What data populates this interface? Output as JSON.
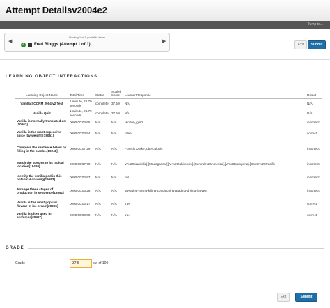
{
  "header": {
    "title": "Attempt Detailsv2004e2"
  },
  "topbar": {
    "jump_label": "Jump to..."
  },
  "pager": {
    "count_text": "Viewing 1 of 1 gradable items",
    "user_name": "Fred Bloggs (Attempt 1 of 1)"
  },
  "actions": {
    "exit_label": "Exit",
    "submit_label": "Submit"
  },
  "interactions": {
    "section_title": "LEARNING OBJECT INTERACTIONS",
    "columns": [
      "Learning Object Name",
      "Total Time",
      "Status",
      "Scaled Score",
      "Learner Response",
      "Result"
    ],
    "rows": [
      {
        "name": "Vanilla SCORM 2004 v2 Test",
        "time": "1 minute, 26.79 seconds",
        "status": "complete",
        "score": "37.5%",
        "response": "N/A",
        "result": "N/A"
      },
      {
        "name": "Vanilla Quiz",
        "time": "1 minute, 26.79 seconds",
        "status": "complete",
        "score": "37.5%",
        "response": "N/A",
        "result": "N/A"
      },
      {
        "name": "Vanilla is normally translated as:[10067]",
        "time": "0000:00:04.65",
        "status": "N/A",
        "score": "N/A",
        "response": "Hidden_gold",
        "result": "incorrect"
      },
      {
        "name": "Vanilla is the most expensive spice (by weight)[19061]",
        "time": "0000:00:03.54",
        "status": "N/A",
        "score": "N/A",
        "response": "false",
        "result": "correct"
      },
      {
        "name": "Complete the sentence below by filling in the blanks.[19248]",
        "time": "0000:00:07.29",
        "status": "N/A",
        "score": "N/A",
        "response": "Francis Drake;tuberculosis",
        "result": "incorrect"
      },
      {
        "name": "Match the species to its typical location[19420]",
        "time": "0000:00:07.70",
        "status": "N/A",
        "score": "N/A",
        "response": "V.%20planifolia[.]Madagascar[,]V.%20tahitensis[.]Central%20America[,]V.%20pompona[.]South%20Pacific",
        "result": "incorrect"
      },
      {
        "name": "Identify the vanilla pod in this botanical drawing[19683]",
        "time": "0000:00:04.97",
        "status": "N/A",
        "score": "N/A",
        "response": "null",
        "result": "incorrect"
      },
      {
        "name": "Arrange these stages of production in sequence[19851]",
        "time": "0000:00:06.28",
        "status": "N/A",
        "score": "N/A",
        "response": "sweating-curing-killing-conditioning-grading-drying-harvest",
        "result": "incorrect"
      },
      {
        "name": "Vanilla is the most popular flavour of ice-cream[20065]",
        "time": "0000:00:03.17",
        "status": "N/A",
        "score": "N/A",
        "response": "true",
        "result": "correct"
      },
      {
        "name": "Vanilla is often used in perfumes[20497]",
        "time": "0000:00:03.90",
        "status": "N/A",
        "score": "N/A",
        "response": "true",
        "result": "correct"
      }
    ]
  },
  "grade": {
    "section_title": "GRADE",
    "label": "Grade",
    "value": "37.5",
    "out_of_text": "out of 100"
  },
  "colors": {
    "submit": "#1f6fa6",
    "topbar": "#555555"
  }
}
